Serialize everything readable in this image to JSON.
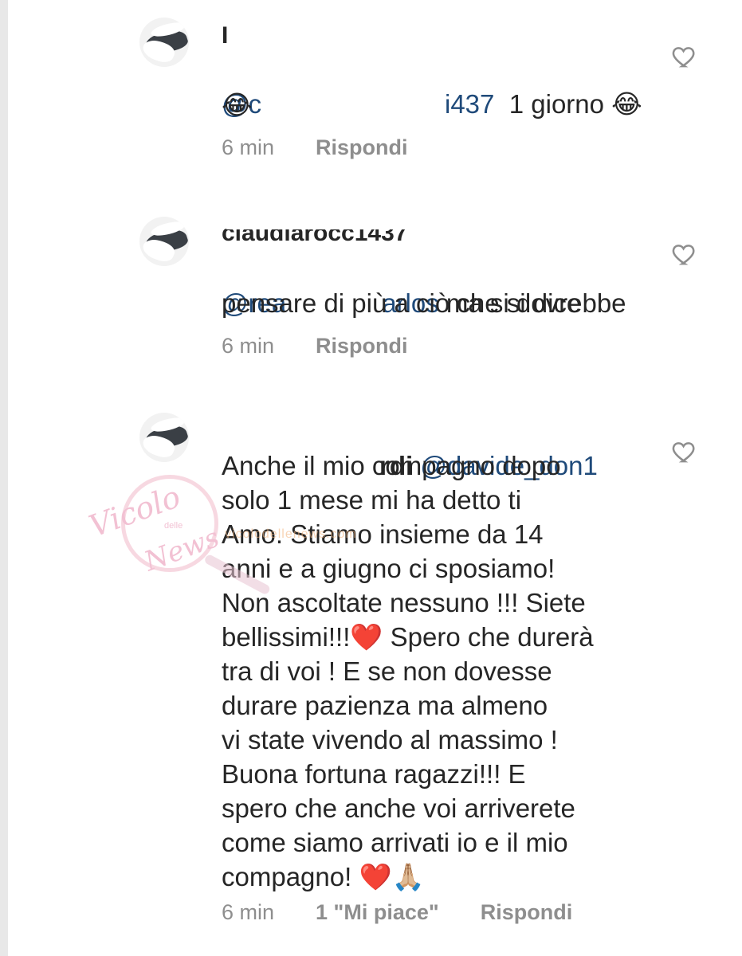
{
  "comments": [
    {
      "username": "I",
      "mention": "@c",
      "mention_tail": "i437",
      "text": "1 giorno",
      "emoji_inline": "😂",
      "emoji_line2": "😂",
      "time": "6 min",
      "reply_label": "Rispondi"
    },
    {
      "username": "claudiarocc1437",
      "mention": "@rea",
      "mention_tail": "arlos",
      "text_line1": "ma si dovrebbe",
      "text_line2": "pensare di più a ciò che si dice",
      "time": "6 min",
      "reply_label": "Rispondi"
    },
    {
      "username": "rdi",
      "mention": "@davide_don1",
      "text": "Anche il mio compagno dopo\nsolo 1 mese mi ha detto ti\nAmo. Stiamo insieme da 14\nanni e a giugno ci sposiamo!\nNon ascoltate nessuno !!! Siete\nbellissimi!!!❤️ Spero che durerà\ntra di voi ! E se non dovesse\ndurare pazienza ma almeno\nvi state vivendo al massimo !\nBuona fortuna ragazzi!!! E\nspero che anche voi arriverete\ncome siamo arrivati io e il mio\ncompagno! ❤️🙏🏼",
      "time": "6 min",
      "likes_label": "1 \"Mi piace\"",
      "reply_label": "Rispondi"
    }
  ],
  "watermark": {
    "title": "Vicolo",
    "middle": "delle",
    "sub": "News",
    "url": "vicolodellenews.com"
  },
  "icons": {
    "like": "heart-outline-icon",
    "avatar": "avatar"
  },
  "colors": {
    "text": "#262626",
    "secondary": "#8e8e8e",
    "mention": "#1f4a7a"
  }
}
